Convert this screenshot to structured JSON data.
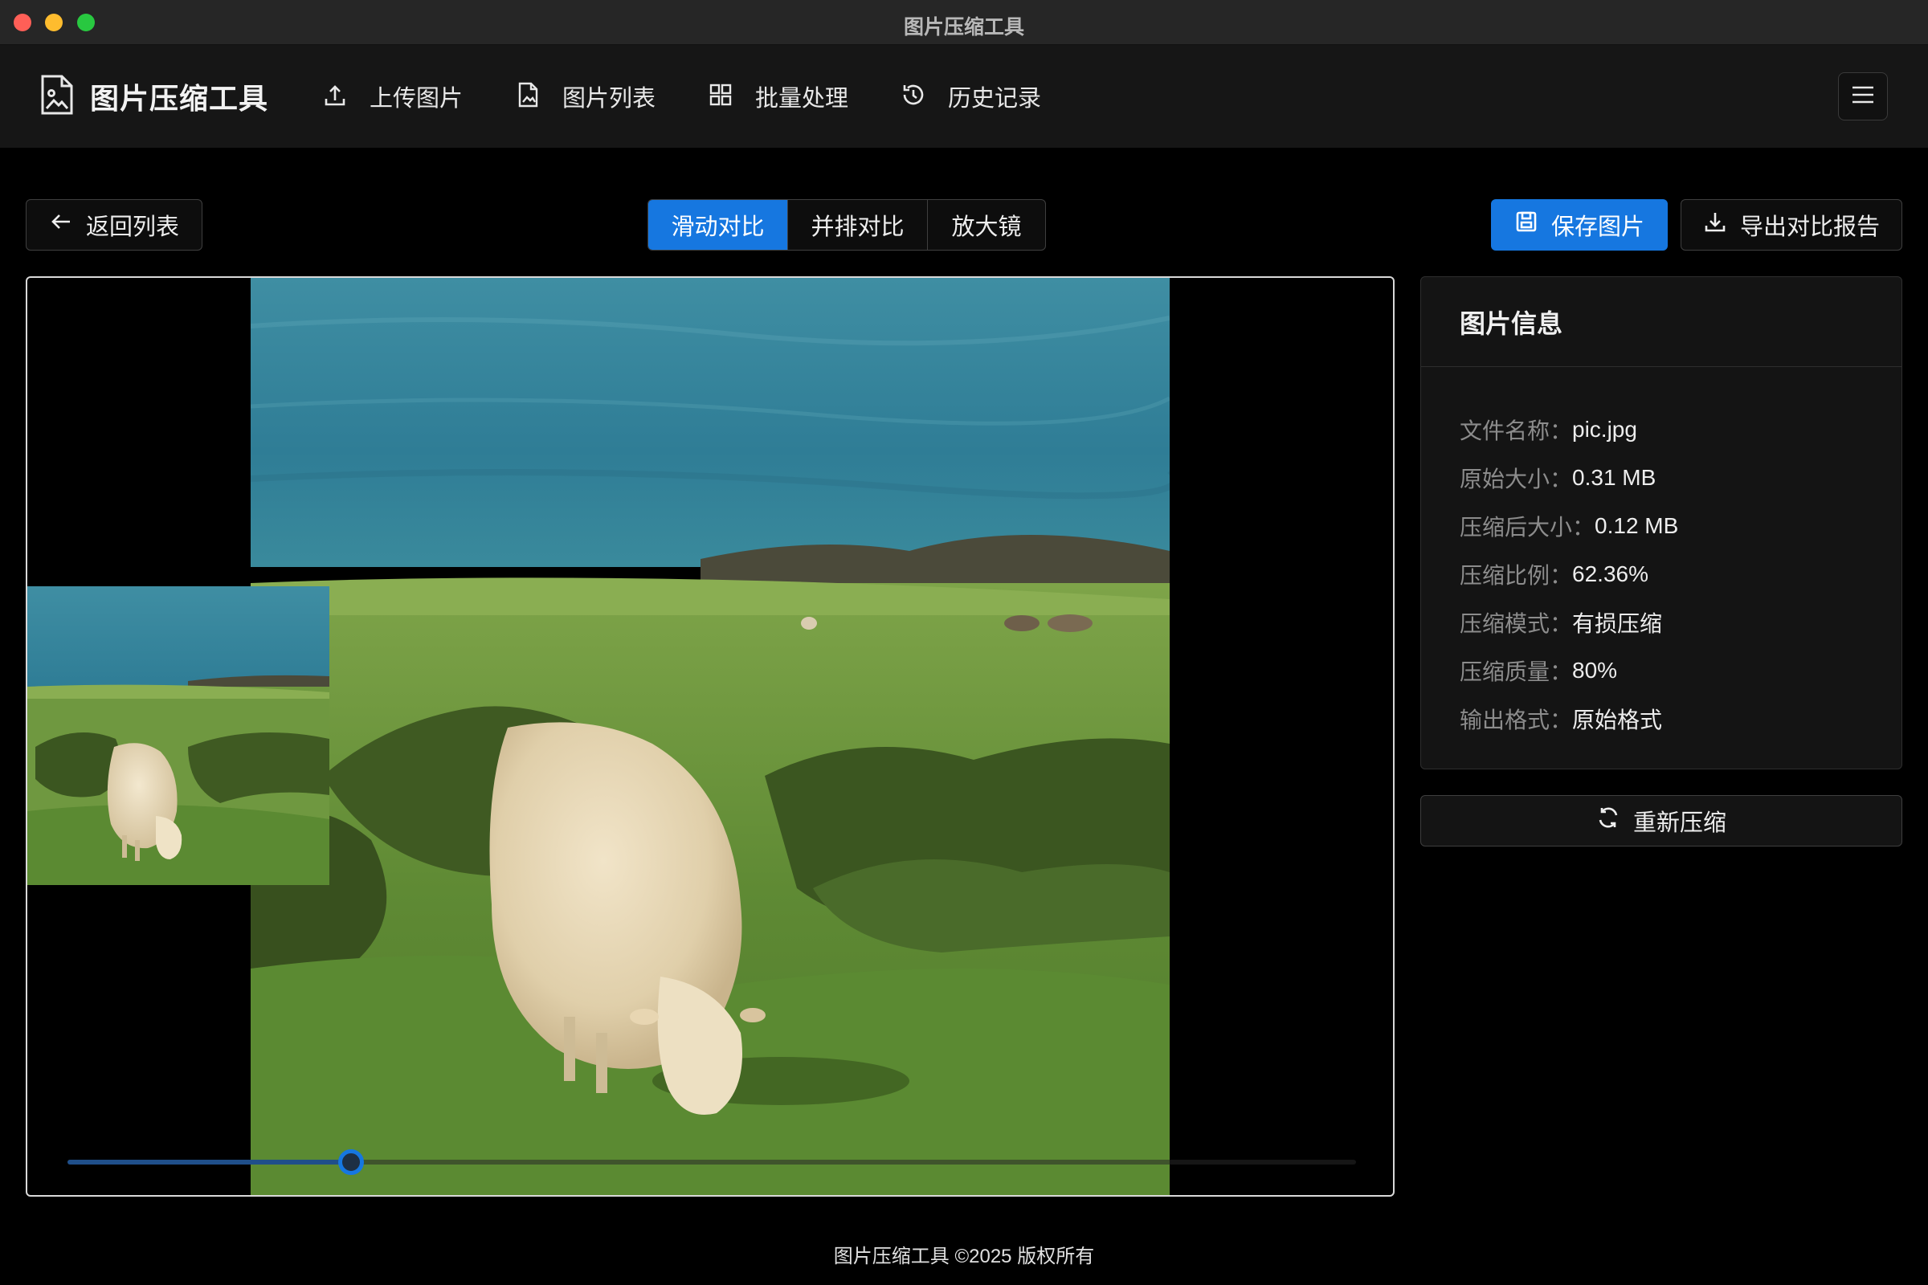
{
  "window": {
    "title": "图片压缩工具"
  },
  "header": {
    "brand": "图片压缩工具",
    "nav": [
      {
        "label": "上传图片",
        "icon": "upload-icon"
      },
      {
        "label": "图片列表",
        "icon": "file-image-icon"
      },
      {
        "label": "批量处理",
        "icon": "grid-icon"
      },
      {
        "label": "历史记录",
        "icon": "history-icon"
      }
    ],
    "menu_icon": "hamburger-menu-icon"
  },
  "toolbar": {
    "back_label": "返回列表",
    "modes": [
      "滑动对比",
      "并排对比",
      "放大镜"
    ],
    "active_mode": "滑动对比",
    "save_label": "保存图片",
    "export_label": "导出对比报告"
  },
  "viewer": {
    "slider_percent": 22
  },
  "info": {
    "title": "图片信息",
    "rows": [
      {
        "label": "文件名称：",
        "value": "pic.jpg"
      },
      {
        "label": "原始大小：",
        "value": "0.31 MB"
      },
      {
        "label": "压缩后大小：",
        "value": "0.12 MB"
      },
      {
        "label": "压缩比例：",
        "value": "62.36%"
      },
      {
        "label": "压缩模式：",
        "value": "有损压缩"
      },
      {
        "label": "压缩质量：",
        "value": "80%"
      },
      {
        "label": "输出格式：",
        "value": "原始格式"
      }
    ],
    "recompress_label": "重新压缩"
  },
  "footer": {
    "text": "图片压缩工具 ©2025 版权所有"
  },
  "colors": {
    "accent": "#1677e0",
    "background": "#000000",
    "panel": "#141414"
  }
}
